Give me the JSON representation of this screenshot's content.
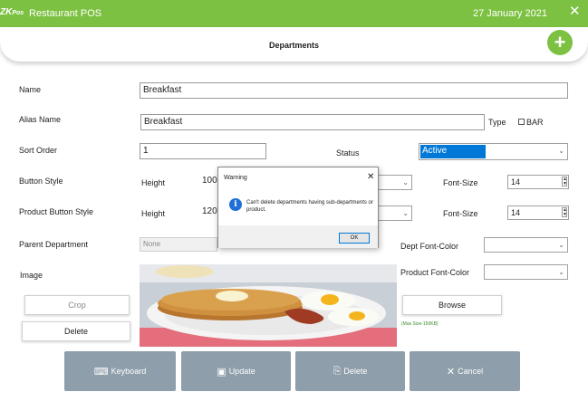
{
  "header": {
    "logo_main": "ZK",
    "logo_sub": "Pos",
    "app_title": "Restaurant POS",
    "date": "27 January 2021",
    "close_glyph": "✕"
  },
  "page": {
    "title": "Departments",
    "add_glyph": "+"
  },
  "form": {
    "name_label": "Name",
    "name_value": "Breakfast",
    "alias_label": "Alias Name",
    "alias_value": "Breakfast",
    "type_label": "Type",
    "bar_label": "BAR",
    "bar_checked": false,
    "sort_label": "Sort Order",
    "sort_value": "1",
    "status_label": "Status",
    "status_value": "Active",
    "button_style_label": "Button Style",
    "height_label": "Height",
    "button_height": "100",
    "font_size_label": "Font-Size",
    "button_font_size": "14",
    "product_button_style_label": "Product Button Style",
    "product_height": "120",
    "product_font_size": "14",
    "parent_label": "Parent Department",
    "parent_value": "None",
    "dept_font_color_label": "Dept Font-Color",
    "product_font_color_label": "Product Font-Color",
    "image_label": "Image"
  },
  "image_buttons": {
    "crop": "Crop",
    "delete": "Delete",
    "browse": "Browse",
    "max_size": "(Max Size-150KB)"
  },
  "actions": {
    "keyboard": "Keyboard",
    "update": "Update",
    "delete": "Delete",
    "cancel": "Cancel"
  },
  "dialog": {
    "title": "Warning",
    "message": "Can't delete departments having sub-departments or product.",
    "ok": "OK",
    "icon": "i",
    "close": "✕"
  },
  "icons": {
    "keyboard": "keyboard-icon",
    "update": "save-icon",
    "delete": "delete-document-icon",
    "cancel": "close-icon",
    "info": "info-icon",
    "caret": "chevron-down-icon"
  },
  "colors": {
    "header_green": "#7dc142",
    "action_button": "#8e9eaa",
    "selection_blue": "#0078d7",
    "info_blue": "#1f6fd6"
  }
}
